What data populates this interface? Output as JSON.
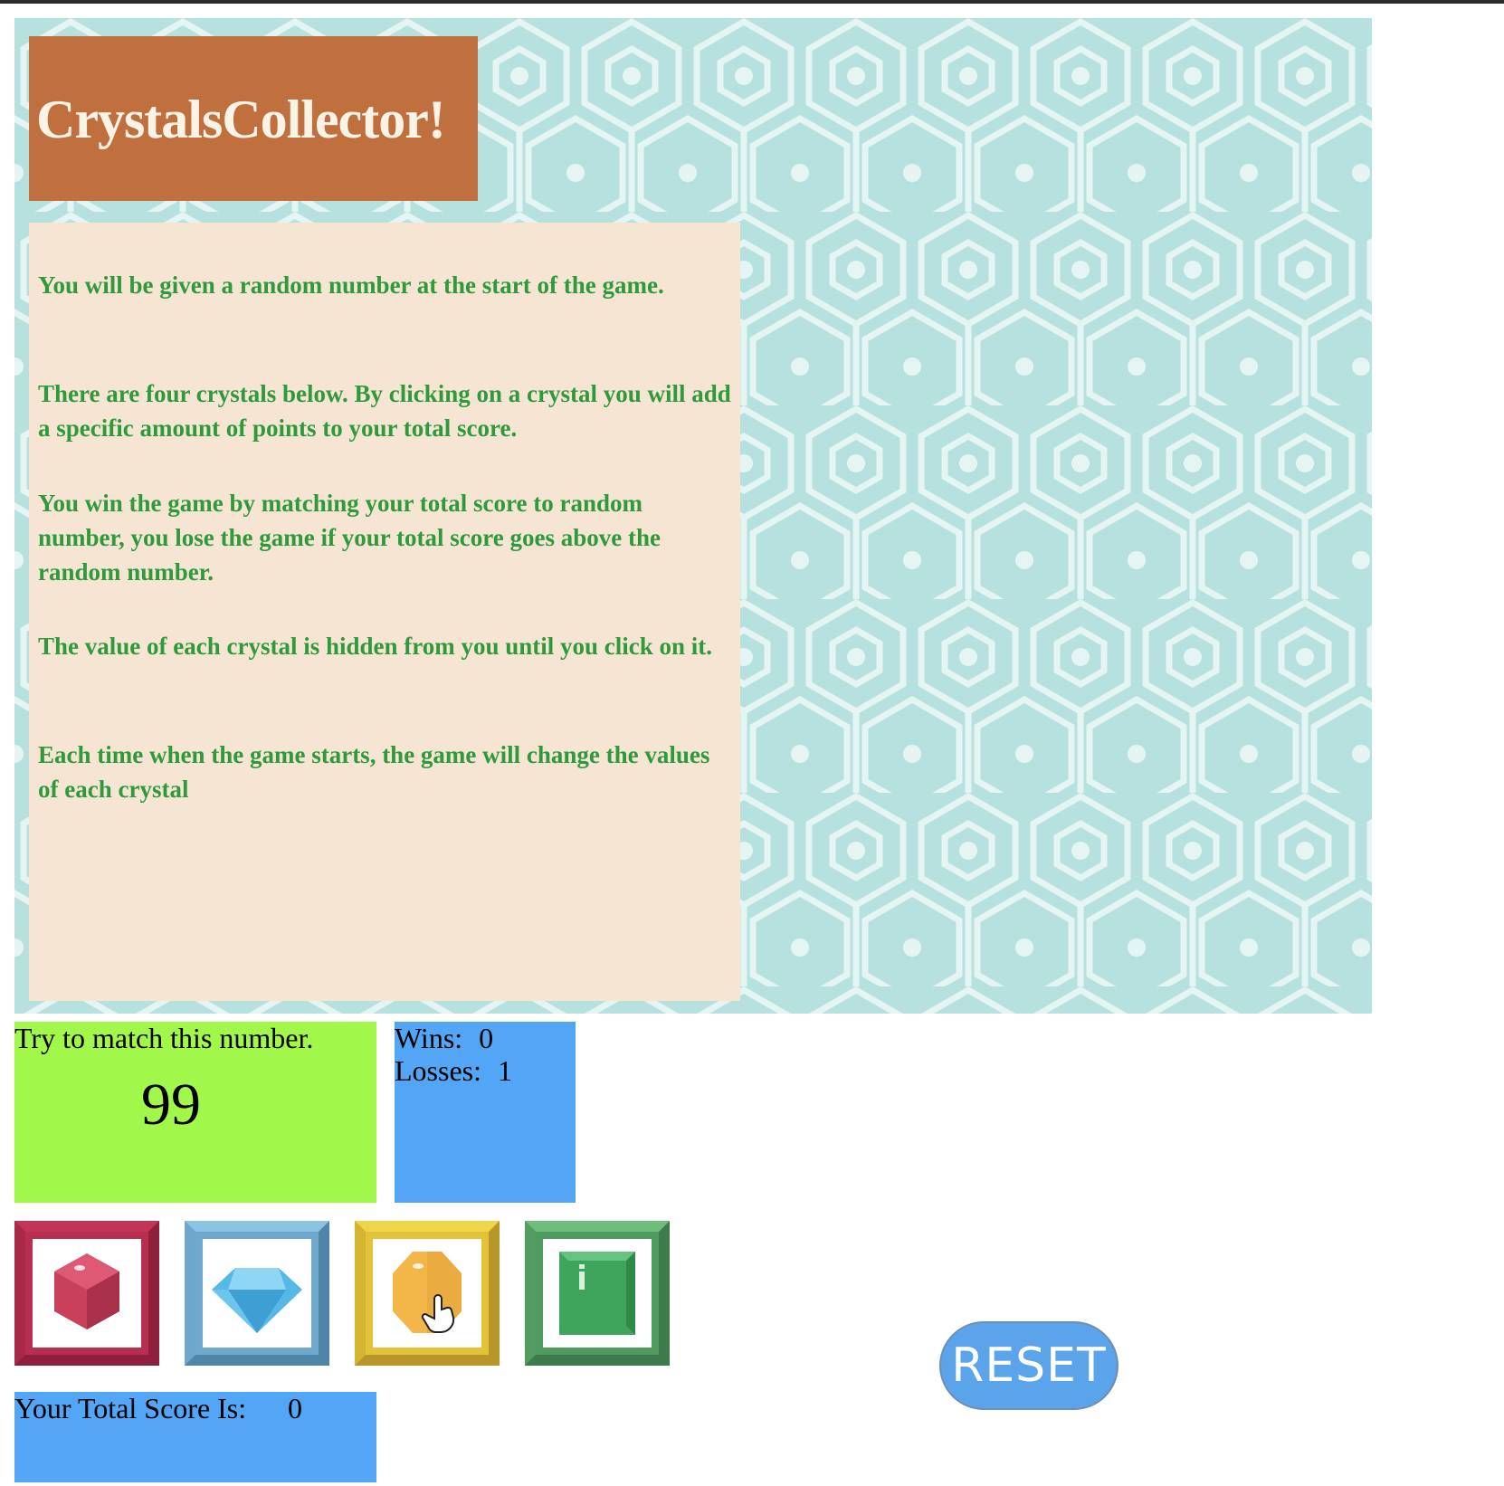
{
  "header": {
    "title": "CrystalsCollector!"
  },
  "instructions": [
    "You will be given a random number at the start of the game.",
    "There are four crystals below. By clicking on a crystal you will add a specific amount of points to your total score.",
    "You win the game by matching your total score to random number, you lose the game if your total score goes above the random number.",
    "The value of each crystal is hidden from you until you click on it.",
    "Each time when the game starts, the game will change the values of each crystal"
  ],
  "target": {
    "label": "Try to match this number.",
    "number": "99"
  },
  "stats": {
    "wins_label": "Wins:",
    "wins": "0",
    "losses_label": "Losses:",
    "losses": "1"
  },
  "crystals": [
    {
      "name": "red-crystal",
      "color": "#c8405c",
      "frame": "#b42a4c"
    },
    {
      "name": "blue-crystal",
      "color": "#56b8e6",
      "frame": "#6fa8cc"
    },
    {
      "name": "yellow-crystal",
      "color": "#f2b649",
      "frame": "#d9b530"
    },
    {
      "name": "green-crystal",
      "color": "#3fa55c",
      "frame": "#4f9a5f"
    }
  ],
  "score": {
    "label": "Your Total Score Is:",
    "value": "0"
  },
  "reset": {
    "label": "RESET"
  },
  "colors": {
    "title_bg": "#c0703f",
    "instructions_bg": "#f7e5d4",
    "instructions_text": "#2f9a3d",
    "pattern_bg": "#b6e1df",
    "target_bg": "#a1f84a",
    "stats_bg": "#53a5f5",
    "reset_bg": "#5ba4ea"
  }
}
